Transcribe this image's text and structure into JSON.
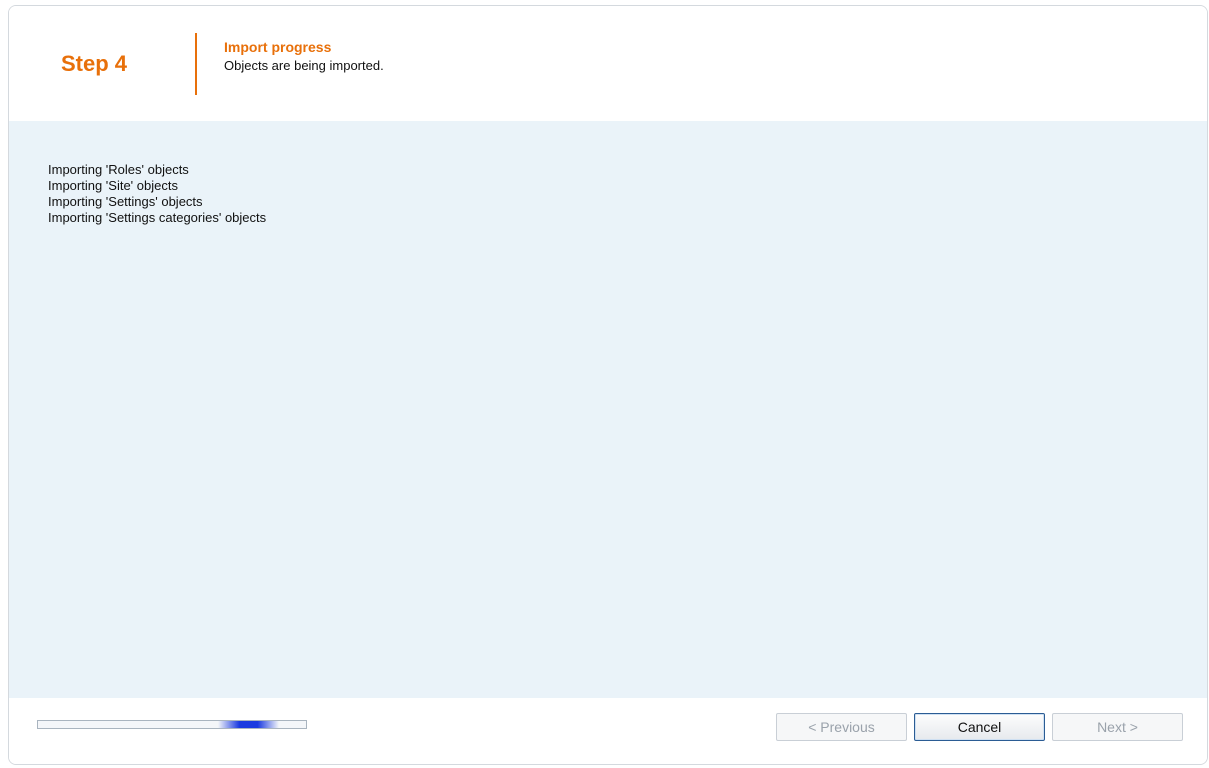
{
  "header": {
    "step": "Step 4",
    "title": "Import progress",
    "subtitle": "Objects are being imported."
  },
  "log": {
    "lines": [
      "Importing 'Roles' objects",
      "Importing 'Site' objects",
      "Importing 'Settings' objects",
      "Importing 'Settings categories' objects"
    ]
  },
  "footer": {
    "progress": {
      "indicator": "indeterminate",
      "indicator_start": 0.67,
      "indicator_end": 0.9,
      "color": "#1a3ae0"
    },
    "buttons": {
      "previous": "< Previous",
      "cancel": "Cancel",
      "next": "Next >"
    }
  },
  "colors": {
    "accent": "#e8700a",
    "content_background": "#eaf3f9",
    "disabled_text": "#9aa2ab"
  }
}
